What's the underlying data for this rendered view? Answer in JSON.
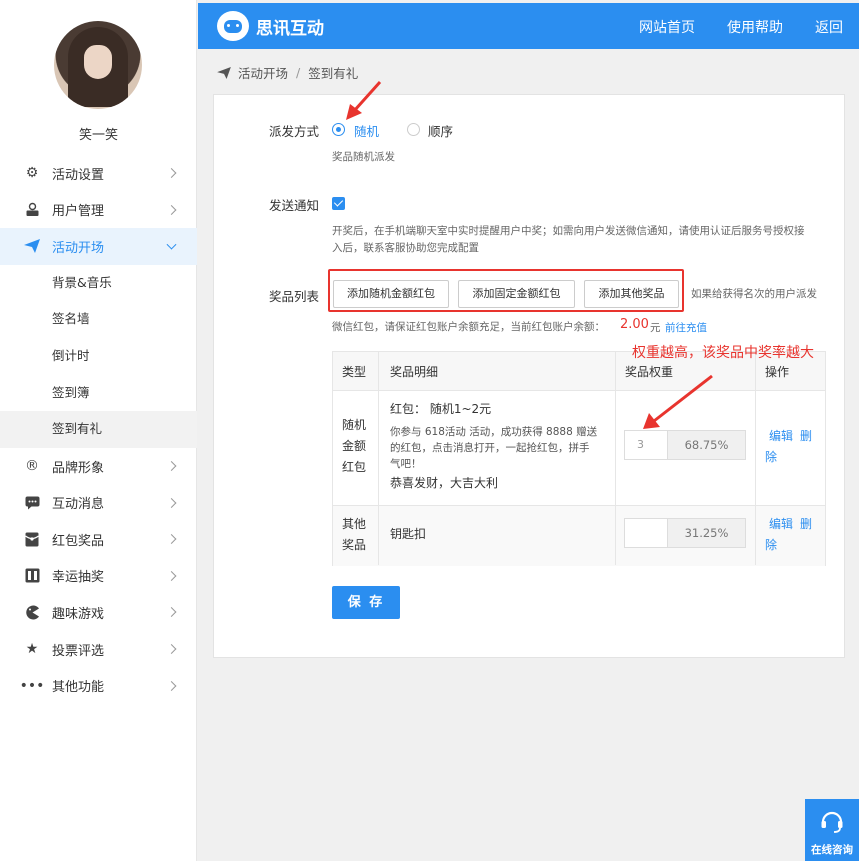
{
  "user": {
    "name": "笑一笑"
  },
  "header": {
    "brand": "思讯互动",
    "nav": [
      "网站首页",
      "使用帮助",
      "返回"
    ]
  },
  "sidebar": {
    "items": [
      {
        "label": "活动设置",
        "icon": "gears-icon"
      },
      {
        "label": "用户管理",
        "icon": "user-card-icon"
      },
      {
        "label": "活动开场",
        "icon": "paper-plane-icon",
        "active": true
      }
    ],
    "subitems": [
      "背景&音乐",
      "签名墙",
      "倒计时",
      "签到簿",
      "签到有礼"
    ],
    "items_after": [
      {
        "label": "品牌形象",
        "icon": "registered-icon"
      },
      {
        "label": "互动消息",
        "icon": "chat-icon"
      },
      {
        "label": "红包奖品",
        "icon": "red-packet-icon"
      },
      {
        "label": "幸运抽奖",
        "icon": "lottery-icon"
      },
      {
        "label": "趣味游戏",
        "icon": "game-icon"
      },
      {
        "label": "投票评选",
        "icon": "star-icon"
      },
      {
        "label": "其他功能",
        "icon": "more-icon"
      }
    ]
  },
  "breadcrumb": {
    "parent": "活动开场",
    "sep": "/",
    "current": "签到有礼"
  },
  "form": {
    "dispatch_label": "派发方式",
    "dispatch_random": "随机",
    "dispatch_order": "顺序",
    "dispatch_hint": "奖品随机派发",
    "notify_label": "发送通知",
    "notify_hint_1": "开奖后，在手机端聊天室中实时提醒用户中奖；如需向用户发送微信通知，请使用认证后服务号授权接",
    "notify_hint_2": "入后，联系客服协助您完成配置",
    "prize_label": "奖品列表",
    "btn_random_redpacket": "添加随机金额红包",
    "btn_fixed_redpacket": "添加固定金额红包",
    "btn_other_prize": "添加其他奖品",
    "prize_tail": "如果给获得名次的用户派发",
    "wechat_hint": "微信红包，请保证红包账户余额充足，当前红包账户余额：",
    "balance": "2.00",
    "balance_unit": "元",
    "recharge": "前往充值"
  },
  "table": {
    "headers": [
      "类型",
      "奖品明细",
      "奖品权重",
      "操作"
    ],
    "rows": [
      {
        "type_lines": [
          "随机",
          "金额",
          "红包"
        ],
        "detail_title": "红包：  随机1~2元",
        "detail_desc_lines": [
          "你参与 618活动 活动，成功获得 8888 赠送",
          "的红包，点击消息打开，一起抢红包，拼手",
          "气吧！"
        ],
        "detail_wish": "恭喜发财，大吉大利",
        "weight_input": "3",
        "weight_pct": "68.75%",
        "edit": "编辑",
        "delete_1": "删",
        "delete_2": "除"
      },
      {
        "type_lines": [
          "其他",
          "奖品"
        ],
        "detail_title": "钥匙扣",
        "weight_input": "",
        "weight_pct": "31.25%",
        "edit": "编辑",
        "delete_1": "删",
        "delete_2": "除"
      }
    ]
  },
  "save": "保 存",
  "annotation": "权重越高，该奖品中奖率越大",
  "consult": "在线咨询",
  "colors": {
    "primary": "#2b8ef0",
    "alert": "#e8342e"
  }
}
